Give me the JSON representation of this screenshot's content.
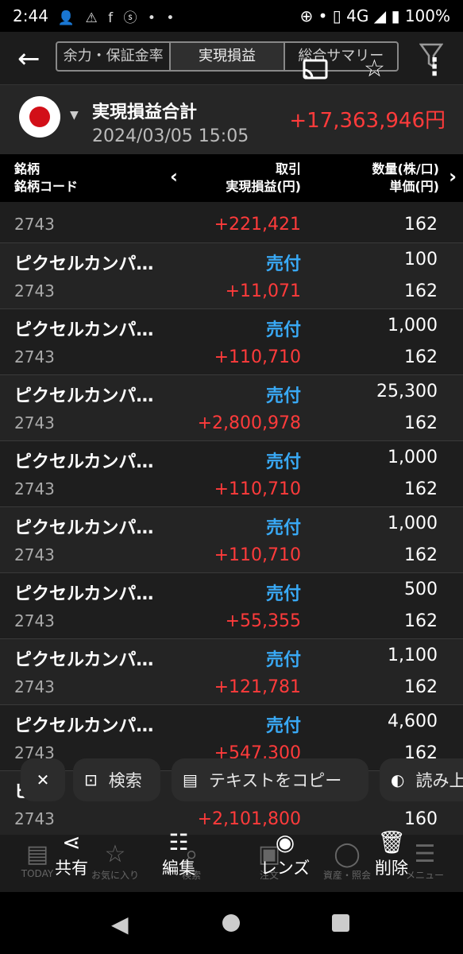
{
  "status": {
    "time": "2:44",
    "notifications": "👤 ⚠ f ⓢ • •",
    "system": "⊕ • ▯ 4G ◢ ▮ 100%"
  },
  "appbar": {
    "tabs": [
      "余力・保証金率",
      "実現損益",
      "総合サマリー"
    ],
    "active_tab": 1
  },
  "summary": {
    "title": "実現損益合計",
    "date": "2024/03/05 15:05",
    "total": "+17,363,946円"
  },
  "header": {
    "col1_line1": "銘柄",
    "col1_line2": "銘柄コード",
    "col2_line1": "取引",
    "col2_line2": "実現損益(円)",
    "col3_line1": "数量(株/口)",
    "col3_line2": "単価(円)"
  },
  "rows": [
    {
      "name": "",
      "side": "",
      "qty": "",
      "code": "2743",
      "pl": "+221,421",
      "price": "162"
    },
    {
      "name": "ピクセルカンパ…",
      "side": "売付",
      "qty": "100",
      "code": "2743",
      "pl": "+11,071",
      "price": "162"
    },
    {
      "name": "ピクセルカンパ…",
      "side": "売付",
      "qty": "1,000",
      "code": "2743",
      "pl": "+110,710",
      "price": "162"
    },
    {
      "name": "ピクセルカンパ…",
      "side": "売付",
      "qty": "25,300",
      "code": "2743",
      "pl": "+2,800,978",
      "price": "162"
    },
    {
      "name": "ピクセルカンパ…",
      "side": "売付",
      "qty": "1,000",
      "code": "2743",
      "pl": "+110,710",
      "price": "162"
    },
    {
      "name": "ピクセルカンパ…",
      "side": "売付",
      "qty": "1,000",
      "code": "2743",
      "pl": "+110,710",
      "price": "162"
    },
    {
      "name": "ピクセルカンパ…",
      "side": "売付",
      "qty": "500",
      "code": "2743",
      "pl": "+55,355",
      "price": "162"
    },
    {
      "name": "ピクセルカンパ…",
      "side": "売付",
      "qty": "1,100",
      "code": "2743",
      "pl": "+121,781",
      "price": "162"
    },
    {
      "name": "ピクセルカンパ…",
      "side": "売付",
      "qty": "4,600",
      "code": "2743",
      "pl": "+547,300",
      "price": "162"
    },
    {
      "name": "ピ",
      "side": "",
      "qty": "",
      "code": "2743",
      "pl": "+2,101,800",
      "price": "160"
    }
  ],
  "lens": {
    "search": "検索",
    "copy_text": "テキストをコピー",
    "read": "読み上"
  },
  "bottom_nav": [
    "TODAY",
    "お気に入り",
    "検索",
    "注文",
    "資産・照会",
    "メニュー"
  ],
  "overlay_actions": [
    "共有",
    "編集",
    "レンズ",
    "削除"
  ],
  "colors": {
    "positive": "#ff3b3b",
    "sell": "#39a9f5",
    "background": "#1e1e1e"
  }
}
